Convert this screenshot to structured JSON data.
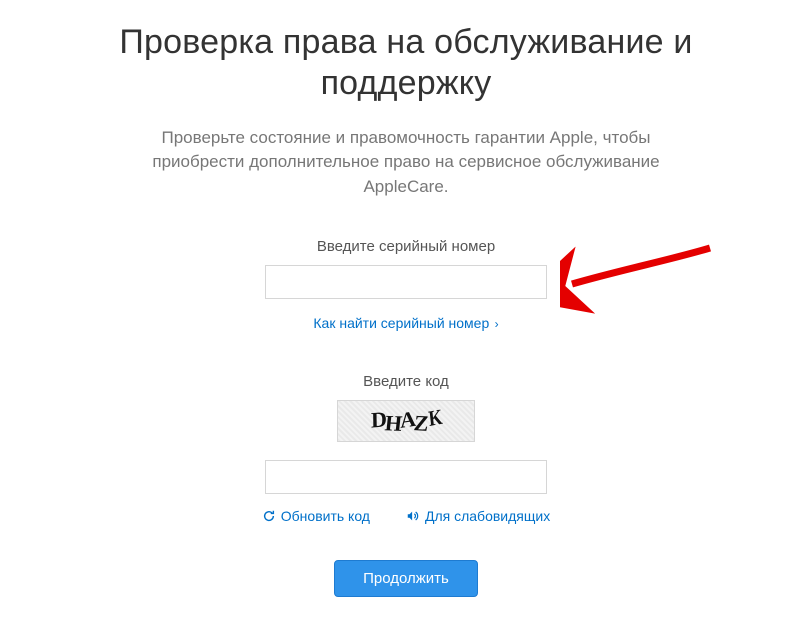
{
  "heading": "Проверка права на обслуживание и поддержку",
  "subheading": "Проверьте состояние и правомочность гарантии Apple, чтобы приобрести дополнительное право на сервисное обслуживание AppleCare.",
  "serial": {
    "label": "Введите серийный номер",
    "value": "",
    "help_link": "Как найти серийный номер"
  },
  "captcha": {
    "label": "Введите код",
    "image_text": "DHAZK",
    "input_value": "",
    "refresh_label": "Обновить код",
    "accessibility_label": "Для слабовидящих"
  },
  "submit_label": "Продолжить"
}
